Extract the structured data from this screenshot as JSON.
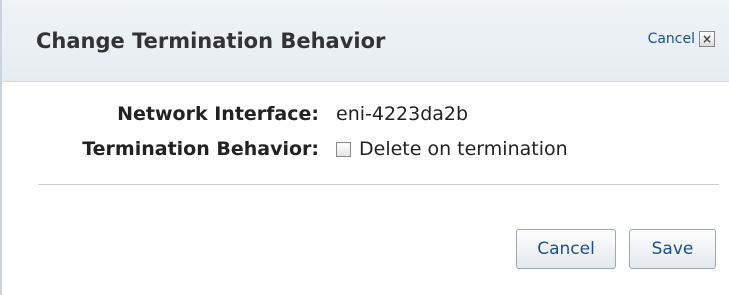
{
  "dialog": {
    "title": "Change Termination Behavior",
    "header_cancel_label": "Cancel",
    "close_glyph": "×",
    "close_icon": "close-icon"
  },
  "fields": {
    "network_interface": {
      "label": "Network Interface:",
      "value": "eni-4223da2b"
    },
    "termination_behavior": {
      "label": "Termination Behavior:",
      "checkbox_label": "Delete on termination",
      "checked": false
    }
  },
  "buttons": {
    "cancel_label": "Cancel",
    "save_label": "Save"
  },
  "colors": {
    "link": "#1a4f8b",
    "header_bg": "#e6edf2"
  }
}
